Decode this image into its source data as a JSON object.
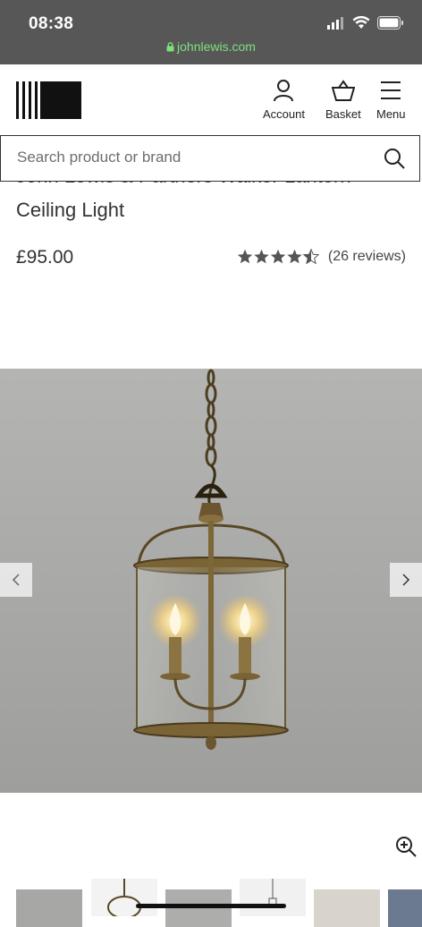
{
  "status": {
    "time": "08:38",
    "url": "johnlewis.com"
  },
  "nav": {
    "account": "Account",
    "basket": "Basket",
    "menu": "Menu"
  },
  "search": {
    "placeholder": "Search product or brand"
  },
  "product": {
    "title_line1": "John Lewis & Partners Walker Lantern",
    "title_line2": "Ceiling Light",
    "price": "£95.00",
    "rating": 4.5,
    "reviews": "(26 reviews)"
  },
  "colors": {
    "statusbar": "#575757",
    "url": "#7ee07e",
    "image_bg": "#a9aaa8"
  },
  "icons": [
    "lock-icon",
    "account-icon",
    "basket-icon",
    "menu-icon",
    "search-icon",
    "chevron-left-icon",
    "chevron-right-icon",
    "zoom-icon"
  ]
}
